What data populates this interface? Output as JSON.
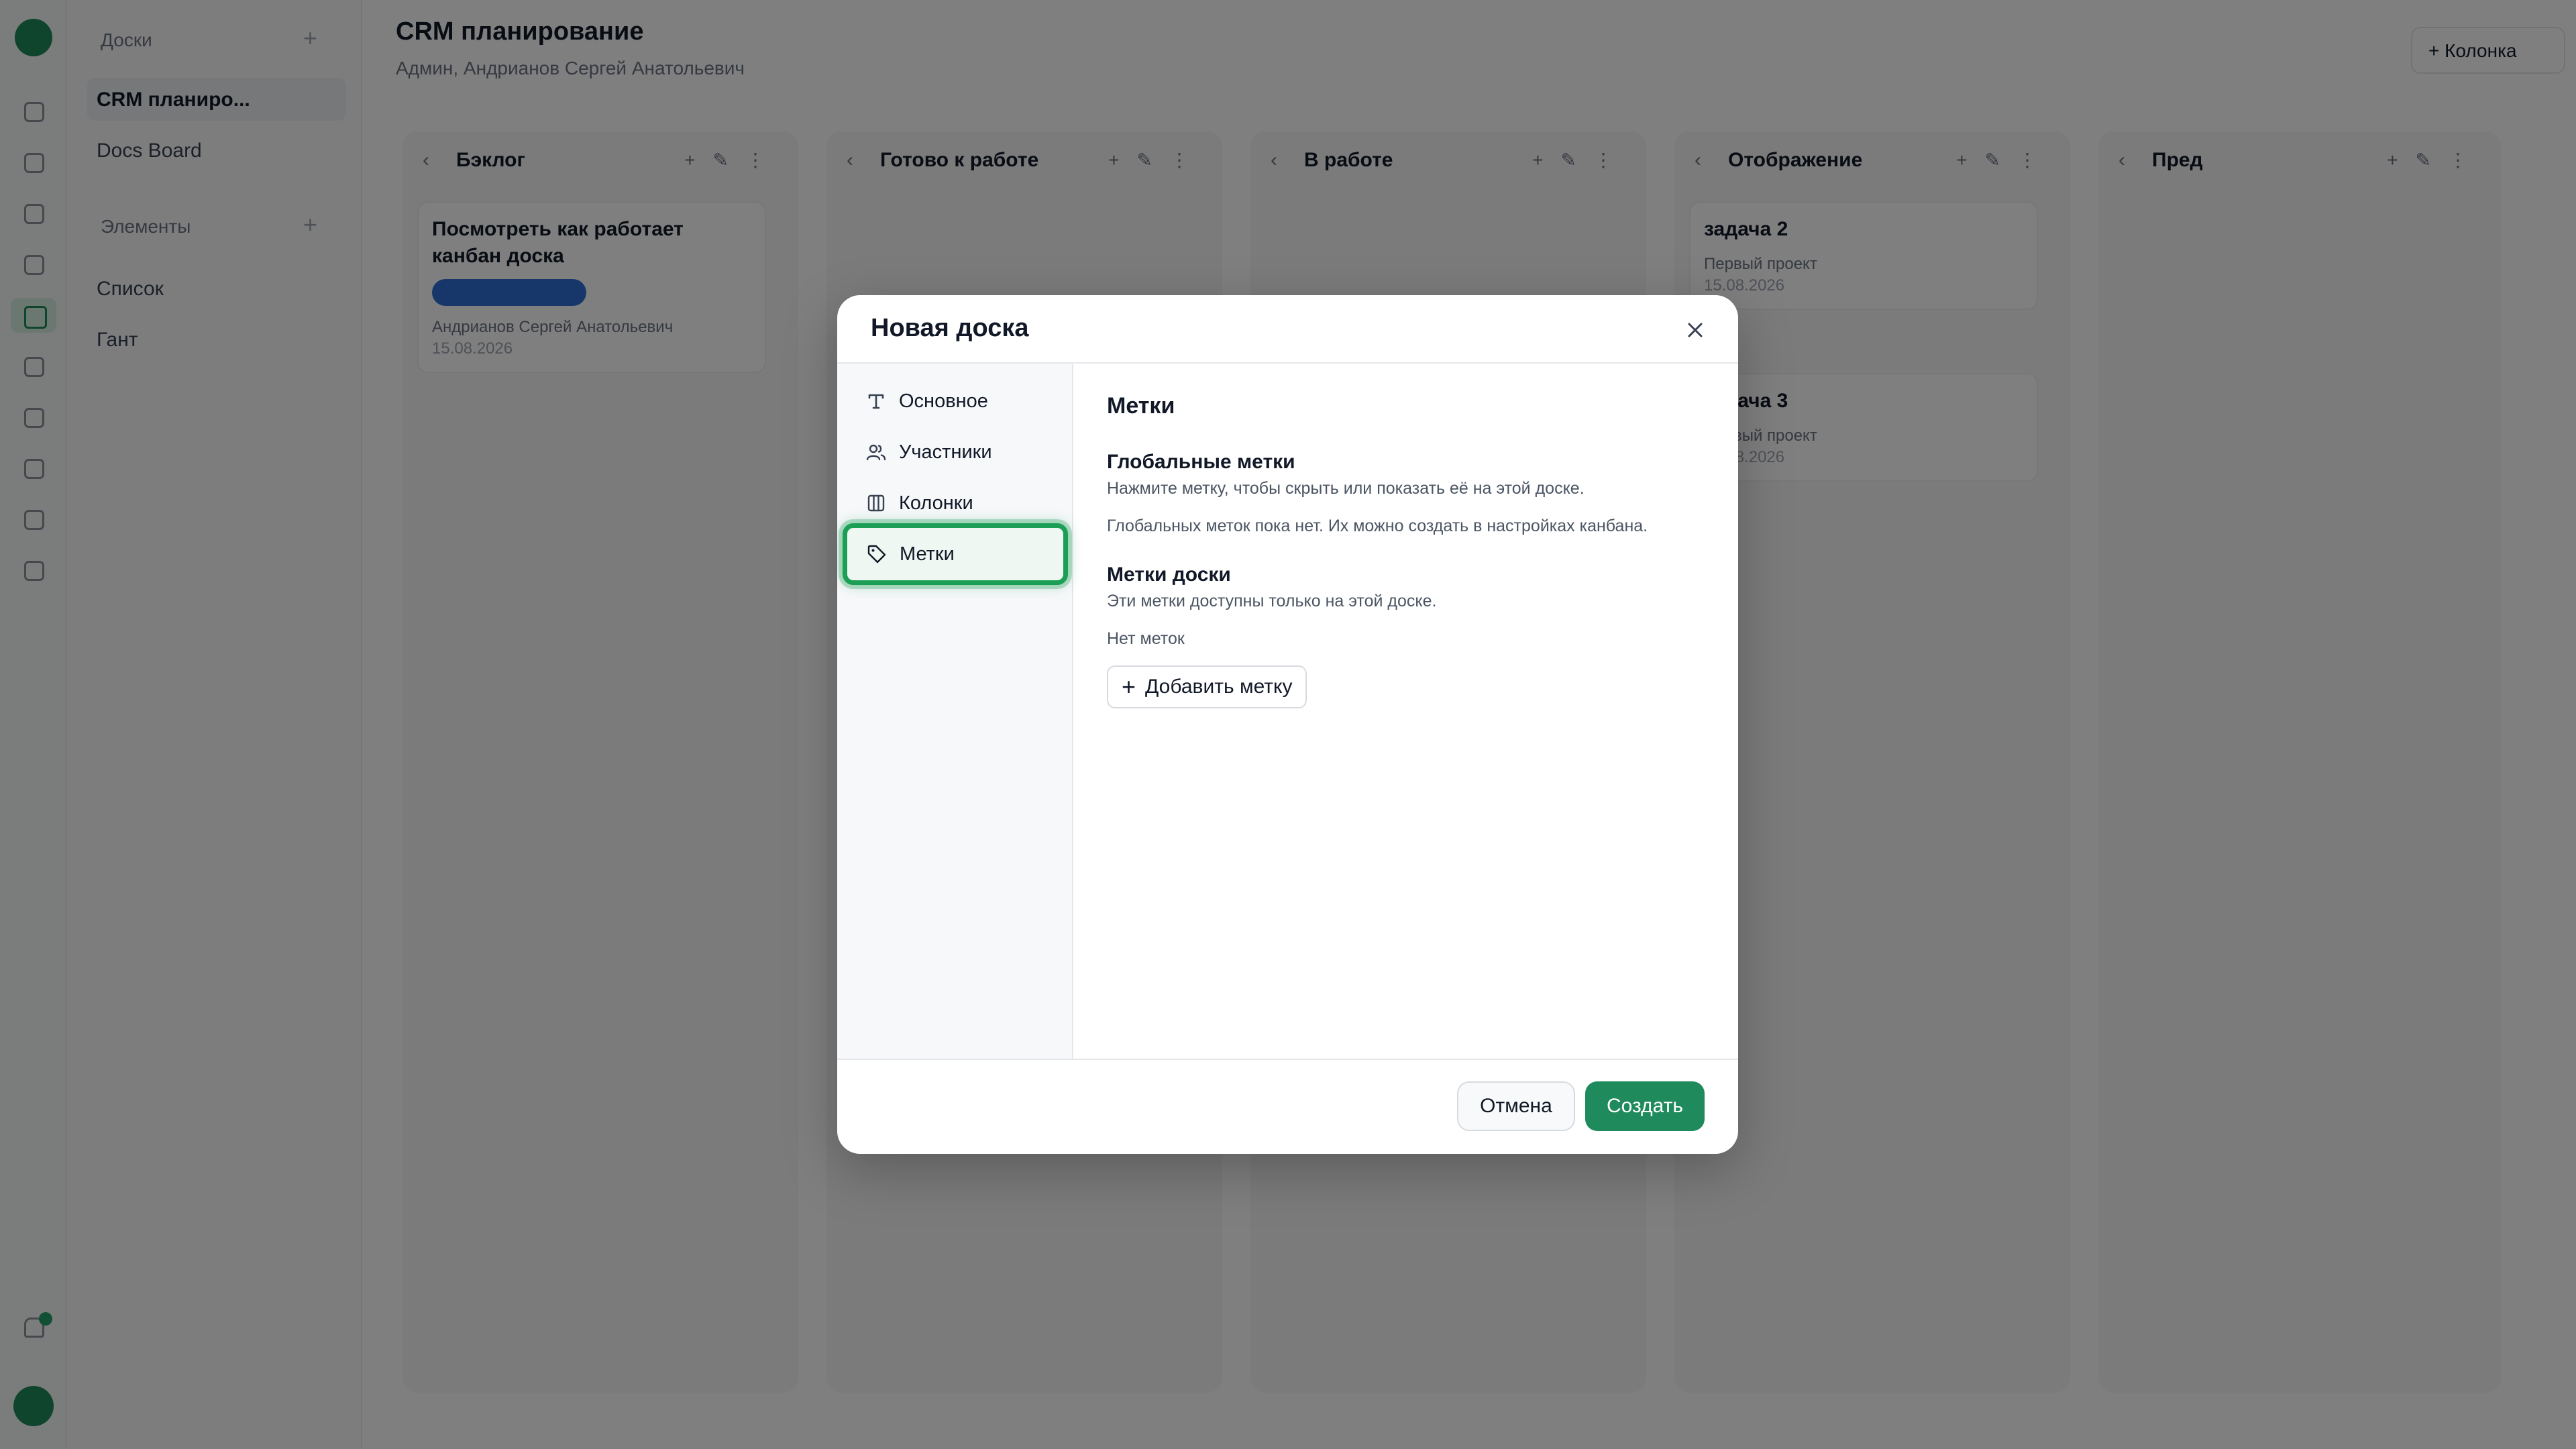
{
  "background": {
    "sidebar": {
      "section1": "Доски",
      "section1_plus": "+",
      "item_active": "CRM планиро...",
      "item2": "Docs Board",
      "section2": "Элементы",
      "section2_plus": "+",
      "item3": "Список",
      "item4": "Гант"
    },
    "header": {
      "title": "CRM планирование",
      "subtitle": "Админ, Андрианов Сергей Анатольевич",
      "right_button": "+ Колонка"
    },
    "columns": [
      {
        "name": "Бэклог",
        "chev": "‹",
        "actions": "+✎⋮"
      },
      {
        "name": "Готово к работе",
        "chev": "‹",
        "actions": "+✎⋮"
      },
      {
        "name": "В работе",
        "chev": "‹",
        "actions": "+✎⋮"
      },
      {
        "name": "Отображение",
        "chev": "‹",
        "actions": "+✎⋮"
      },
      {
        "name": "Пред",
        "chev": "‹",
        "actions": "+✎⋮"
      }
    ],
    "cards": [
      {
        "title": "Посмотреть как работает канбан доска",
        "meta": "Андрианов Сергей Анатольевич",
        "date": "15.08.2026"
      },
      {
        "title": "задача 2",
        "meta": "Первый проект",
        "date": "15.08.2026"
      },
      {
        "title": "задача 3",
        "meta": "Первый проект",
        "date": "15.08.2026"
      }
    ]
  },
  "modal": {
    "title": "Новая доска",
    "close_icon": "close-icon",
    "nav": [
      {
        "label": "Основное",
        "icon": "text-icon"
      },
      {
        "label": "Участники",
        "icon": "users-icon"
      },
      {
        "label": "Колонки",
        "icon": "columns-icon"
      },
      {
        "label": "Метки",
        "icon": "tag-icon",
        "active": true
      }
    ],
    "content": {
      "heading": "Метки",
      "global_title": "Глобальные метки",
      "global_hint": "Нажмите метку, чтобы скрыть или показать её на этой доске.",
      "global_empty": "Глобальных меток пока нет. Их можно создать в настройках канбана.",
      "board_title": "Метки доски",
      "board_hint": "Эти метки доступны только на этой доске.",
      "board_empty": "Нет меток",
      "add_button": "Добавить метку",
      "add_icon": "+"
    },
    "footer": {
      "cancel": "Отмена",
      "create": "Создать"
    }
  },
  "colors": {
    "accent": "#1f8a5b",
    "active_nav_border": "#1a9f55",
    "overlay": "rgba(0,0,0,0.5)"
  }
}
